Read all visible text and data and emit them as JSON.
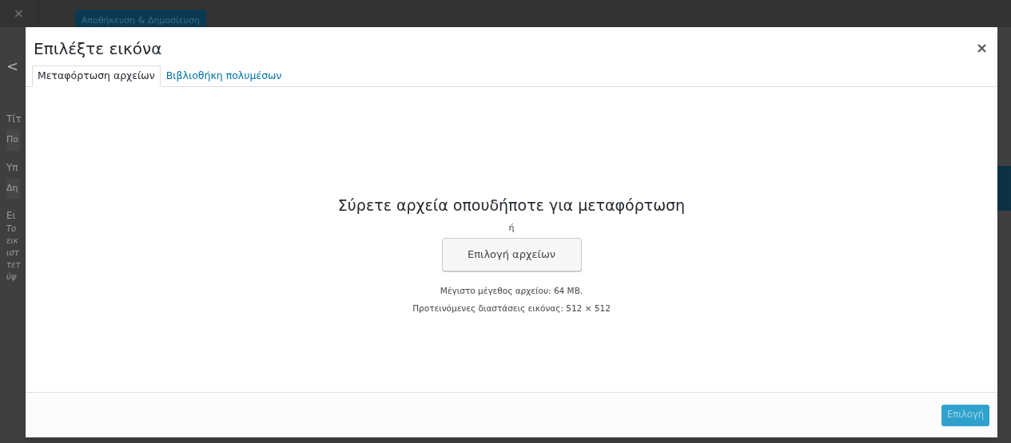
{
  "background": {
    "close_label": "×",
    "publish_button": "Αποθήκευση & Δημοσίευση",
    "back_label": "<",
    "sidebar_fragments": [
      {
        "text": "Τίτ",
        "kind": "label"
      },
      {
        "text": "Πο",
        "kind": "field"
      },
      {
        "text": "Υπ",
        "kind": "label"
      },
      {
        "text": "Δη",
        "kind": "field"
      },
      {
        "text": "Ει",
        "kind": "label"
      },
      {
        "text": "Το",
        "kind": "note"
      },
      {
        "text": "εικ",
        "kind": "note"
      },
      {
        "text": "ιστ",
        "kind": "note"
      },
      {
        "text": "τετ",
        "kind": "note"
      },
      {
        "text": "ύψ",
        "kind": "note"
      }
    ]
  },
  "modal": {
    "title": "Επιλέξτε εικόνα",
    "close_label": "×",
    "tabs": [
      {
        "label": "Μεταφόρτωση αρχείων",
        "selected": true
      },
      {
        "label": "Βιβλιοθήκη πολυμέσων",
        "selected": false
      }
    ],
    "upload": {
      "heading": "Σύρετε αρχεία οπουδήποτε για μεταφόρτωση",
      "or": "ή",
      "button": "Επιλογή αρχείων",
      "max_size": "Μέγιστο μέγεθος αρχείου: 64 MB.",
      "suggested": "Προτεινόμενες διαστάσεις εικόνας: 512 × 512"
    },
    "footer": {
      "button": "Επιλογή",
      "disabled": true
    }
  }
}
